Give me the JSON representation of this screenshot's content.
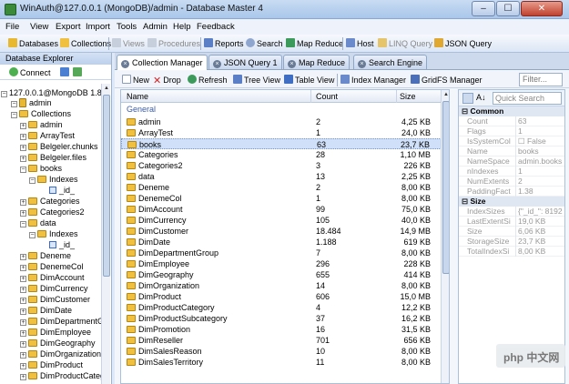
{
  "window": {
    "title": "WinAuth@127.0.0.1 (MongoDB)/admin - Database Master 4",
    "min": "–",
    "max": "☐",
    "close": "✕"
  },
  "menu": [
    "File",
    "View",
    "Export",
    "Import",
    "Tools",
    "Admin",
    "Help",
    "Feedback"
  ],
  "toolbar": {
    "databases": "Databases",
    "collections": "Collections",
    "views": "Views",
    "procedures": "Procedures",
    "reports": "Reports",
    "search": "Search",
    "map_reduce": "Map Reduce",
    "host": "Host",
    "linq_query": "LINQ Query",
    "json_query": "JSON Query"
  },
  "explorer": {
    "title": "Database Explorer",
    "connect": "Connect",
    "root": "127.0.0.1@MongoDB 1.8.1",
    "nodes": [
      "admin",
      "Collections",
      "admin",
      "ArrayTest",
      "Belgeler.chunks",
      "Belgeler.files",
      "books",
      "Indexes",
      "_id_",
      "Categories",
      "Categories2",
      "data",
      "Indexes",
      "_id_",
      "Deneme",
      "DenemeCol",
      "DimAccount",
      "DimCurrency",
      "DimCustomer",
      "DimDate",
      "DimDepartmentG",
      "DimEmployee",
      "DimGeography",
      "DimOrganization",
      "DimProduct",
      "DimProductCateg"
    ]
  },
  "tabs": [
    "Collection Manager",
    "JSON Query 1",
    "Map Reduce",
    "Search Engine"
  ],
  "content_toolbar": {
    "new": "New",
    "drop": "Drop",
    "refresh": "Refresh",
    "tree_view": "Tree View",
    "table_view": "Table View",
    "index_manager": "Index Manager",
    "gridfs_manager": "GridFS Manager",
    "filter_placeholder": "Filter..."
  },
  "grid": {
    "headers": {
      "name": "Name",
      "count": "Count",
      "size": "Size"
    },
    "group": "General",
    "rows": [
      {
        "name": "admin",
        "count": "2",
        "size": "4,25 KB"
      },
      {
        "name": "ArrayTest",
        "count": "1",
        "size": "24,0 KB"
      },
      {
        "name": "books",
        "count": "63",
        "size": "23,7 KB",
        "selected": true
      },
      {
        "name": "Categories",
        "count": "28",
        "size": "1,10 MB"
      },
      {
        "name": "Categories2",
        "count": "3",
        "size": "226 KB"
      },
      {
        "name": "data",
        "count": "13",
        "size": "2,25 KB"
      },
      {
        "name": "Deneme",
        "count": "2",
        "size": "8,00 KB"
      },
      {
        "name": "DenemeCol",
        "count": "1",
        "size": "8,00 KB"
      },
      {
        "name": "DimAccount",
        "count": "99",
        "size": "75,0 KB"
      },
      {
        "name": "DimCurrency",
        "count": "105",
        "size": "40,0 KB"
      },
      {
        "name": "DimCustomer",
        "count": "18.484",
        "size": "14,9 MB"
      },
      {
        "name": "DimDate",
        "count": "1.188",
        "size": "619 KB"
      },
      {
        "name": "DimDepartmentGroup",
        "count": "7",
        "size": "8,00 KB"
      },
      {
        "name": "DimEmployee",
        "count": "296",
        "size": "228 KB"
      },
      {
        "name": "DimGeography",
        "count": "655",
        "size": "414 KB"
      },
      {
        "name": "DimOrganization",
        "count": "14",
        "size": "8,00 KB"
      },
      {
        "name": "DimProduct",
        "count": "606",
        "size": "15,0 MB"
      },
      {
        "name": "DimProductCategory",
        "count": "4",
        "size": "12,2 KB"
      },
      {
        "name": "DimProductSubcategory",
        "count": "37",
        "size": "16,2 KB"
      },
      {
        "name": "DimPromotion",
        "count": "16",
        "size": "31,5 KB"
      },
      {
        "name": "DimReseller",
        "count": "701",
        "size": "656 KB"
      },
      {
        "name": "DimSalesReason",
        "count": "10",
        "size": "8,00 KB"
      },
      {
        "name": "DimSalesTerritory",
        "count": "11",
        "size": "8,00 KB"
      }
    ]
  },
  "properties": {
    "search_placeholder": "Quick Search",
    "sort_label": "A↓",
    "common_label": "Common",
    "common": [
      {
        "k": "Count",
        "v": "63"
      },
      {
        "k": "Flags",
        "v": "1"
      },
      {
        "k": "IsSystemCol",
        "v": "False"
      },
      {
        "k": "Name",
        "v": "books"
      },
      {
        "k": "NameSpace",
        "v": "admin.books"
      },
      {
        "k": "nIndexes",
        "v": "1"
      },
      {
        "k": "NumExtents",
        "v": "2"
      },
      {
        "k": "PaddingFact",
        "v": "1.38"
      }
    ],
    "size_label": "Size",
    "size": [
      {
        "k": "IndexSizes",
        "v": "{\"_id_\": 8192"
      },
      {
        "k": "LastExtentSi",
        "v": "19,0 KB"
      },
      {
        "k": "Size",
        "v": "6,06 KB"
      },
      {
        "k": "StorageSize",
        "v": "23,7 KB"
      },
      {
        "k": "TotalIndexSi",
        "v": "8,00 KB"
      }
    ]
  },
  "watermark": "php 中文网",
  "colors": {
    "folder": "#f0c040",
    "selection": "#cfe0f8",
    "header": "#bcd0ec"
  }
}
